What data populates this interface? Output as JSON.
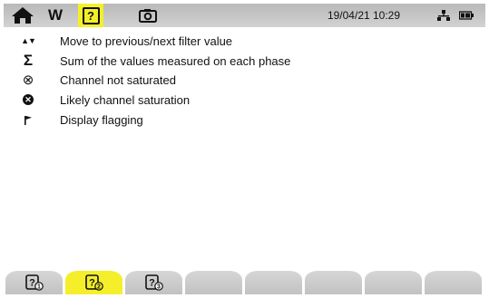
{
  "topbar": {
    "home_icon": "home-icon",
    "w_label": "W",
    "help_label": "?",
    "camera_icon": "camera-icon",
    "datetime": "19/04/21 10:29",
    "network_icon": "network-icon",
    "battery_icon": "battery-icon"
  },
  "help_items": [
    {
      "icon": "up-down-arrows-icon",
      "symbol": "▲▼",
      "text": "Move to previous/next filter value"
    },
    {
      "icon": "sigma-icon",
      "symbol": "Σ",
      "text": "Sum of the values measured on each phase"
    },
    {
      "icon": "circle-x-outline-icon",
      "symbol": "⊗",
      "text": "Channel not saturated"
    },
    {
      "icon": "circle-x-filled-icon",
      "symbol": "✕",
      "text": "Likely channel saturation"
    },
    {
      "icon": "flag-icon",
      "symbol": "⚑",
      "text": "Display flagging"
    }
  ],
  "tabs": [
    {
      "icon": "help-page-1-icon",
      "active": false
    },
    {
      "icon": "help-page-2-icon",
      "active": true
    },
    {
      "icon": "help-page-3-icon",
      "active": false
    },
    {
      "icon": "",
      "active": false
    },
    {
      "icon": "",
      "active": false
    },
    {
      "icon": "",
      "active": false
    },
    {
      "icon": "",
      "active": false
    },
    {
      "icon": "",
      "active": false
    }
  ],
  "colors": {
    "accent": "#f4ef2a",
    "bar": "#c8c8c8",
    "text": "#111111"
  }
}
